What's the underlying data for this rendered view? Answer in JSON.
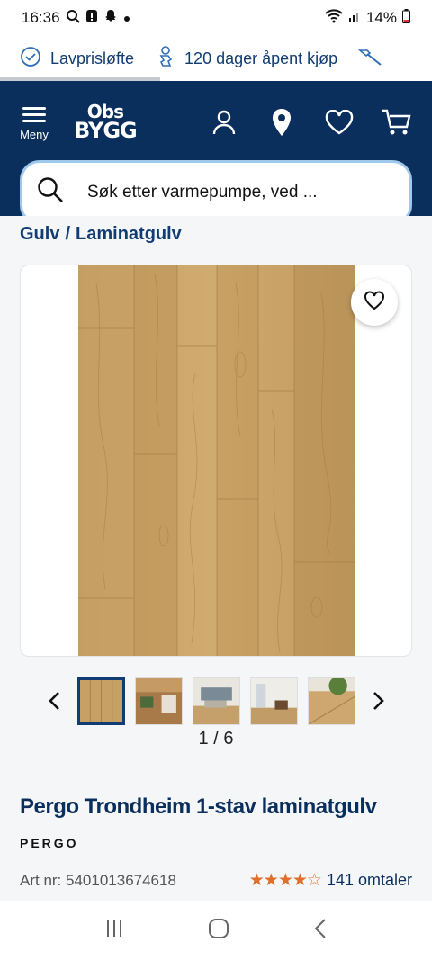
{
  "status_bar": {
    "time": "16:36",
    "battery": "14%"
  },
  "promo": {
    "item1": "Lavprisløfte",
    "item2": "120 dager åpent kjøp"
  },
  "header": {
    "menu_label": "Meny",
    "logo_line1": "Obs",
    "logo_line2": "BYGG",
    "search_placeholder": "Søk etter varmepumpe, ved ..."
  },
  "breadcrumb": {
    "part1": "Gulv",
    "separator": "/",
    "part2": "Laminatgulv"
  },
  "gallery": {
    "pager": "1 / 6"
  },
  "product": {
    "title": "Pergo Trondheim 1-stav laminatgulv",
    "brand": "PERGO",
    "art_nr": "Art nr: 5401013674618",
    "stars": "★★★★☆",
    "rating": 4.5,
    "review_count": "141 omtaler"
  },
  "colors": {
    "navy": "#0b2f5d",
    "star_orange": "#e06f2a"
  }
}
